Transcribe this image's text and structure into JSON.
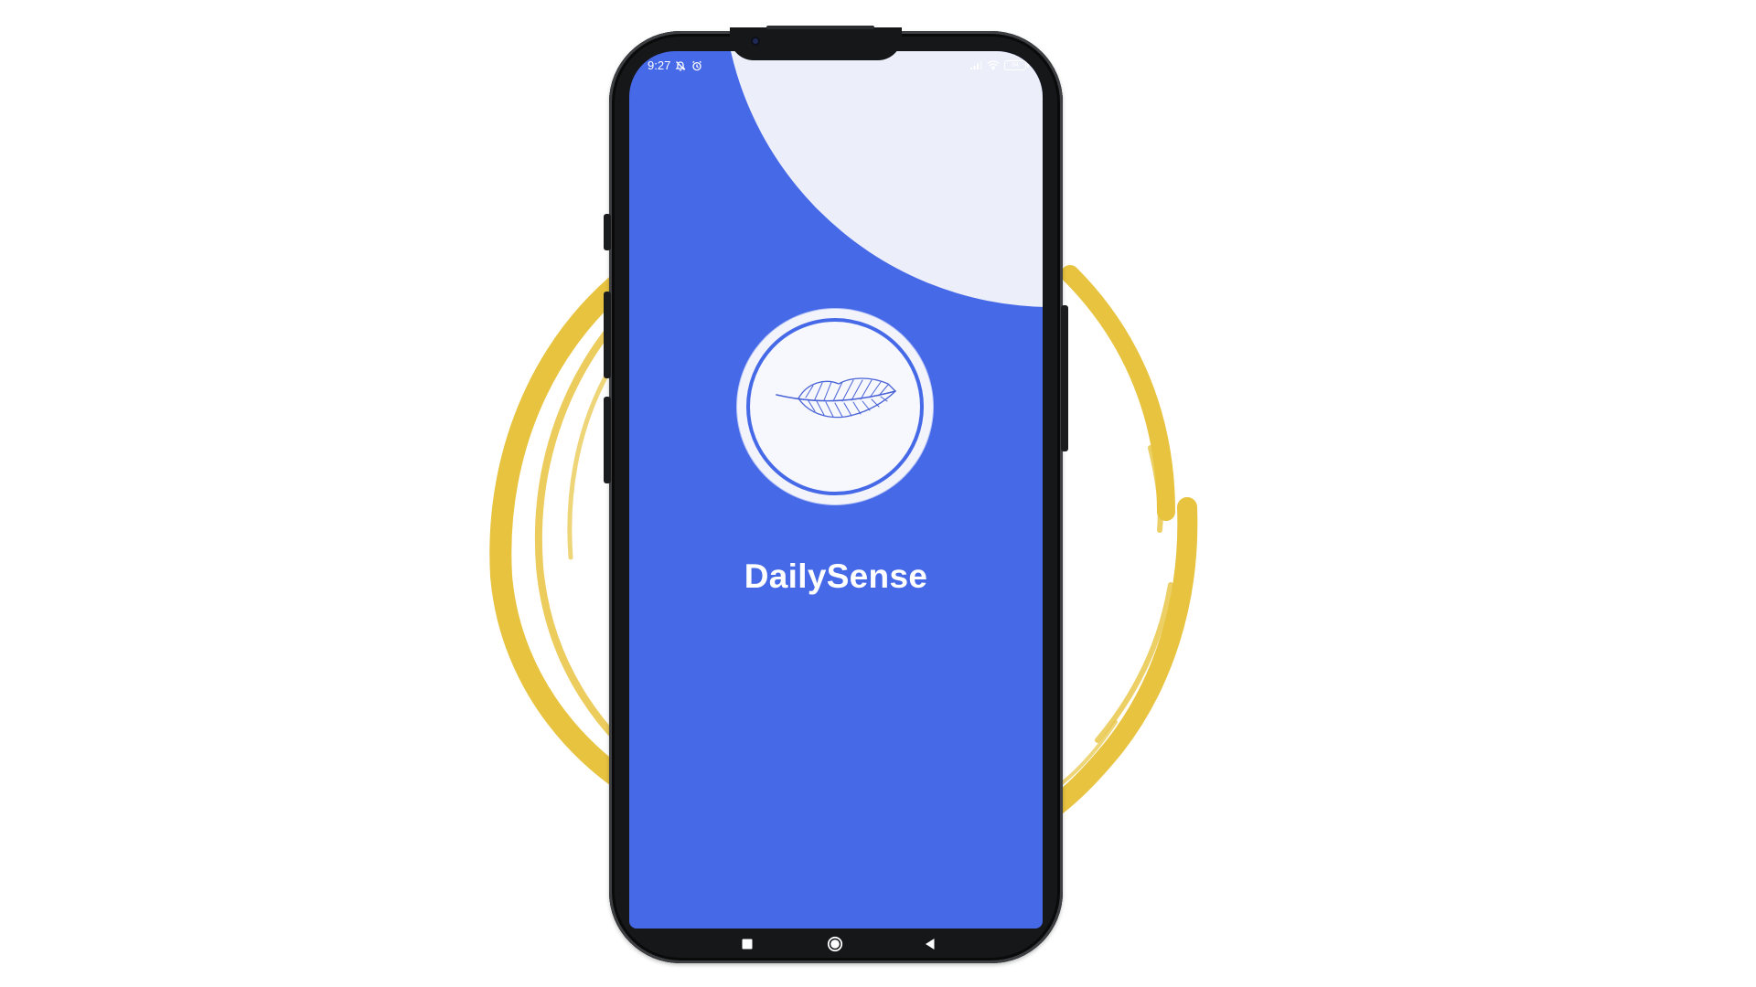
{
  "app": {
    "name": "DailySense"
  },
  "status_bar": {
    "time": "9:27",
    "left_icons": [
      "bell-off-icon",
      "alarm-icon"
    ],
    "right_icons": [
      "signal-icon",
      "wifi-icon",
      "battery-icon"
    ],
    "battery_level": "84"
  },
  "logo": {
    "icon": "feather-icon"
  },
  "navigation": {
    "buttons": [
      {
        "name": "recent-apps-button",
        "icon": "square-icon"
      },
      {
        "name": "home-button",
        "icon": "circle-icon"
      },
      {
        "name": "back-button",
        "icon": "triangle-left-icon"
      }
    ]
  },
  "colors": {
    "screen_background": "#4669e8",
    "accent_blob": "#eceef9",
    "decorative_ring": "#e7c33f",
    "phone_frame": "#161719",
    "page_background": "#ffffff"
  }
}
